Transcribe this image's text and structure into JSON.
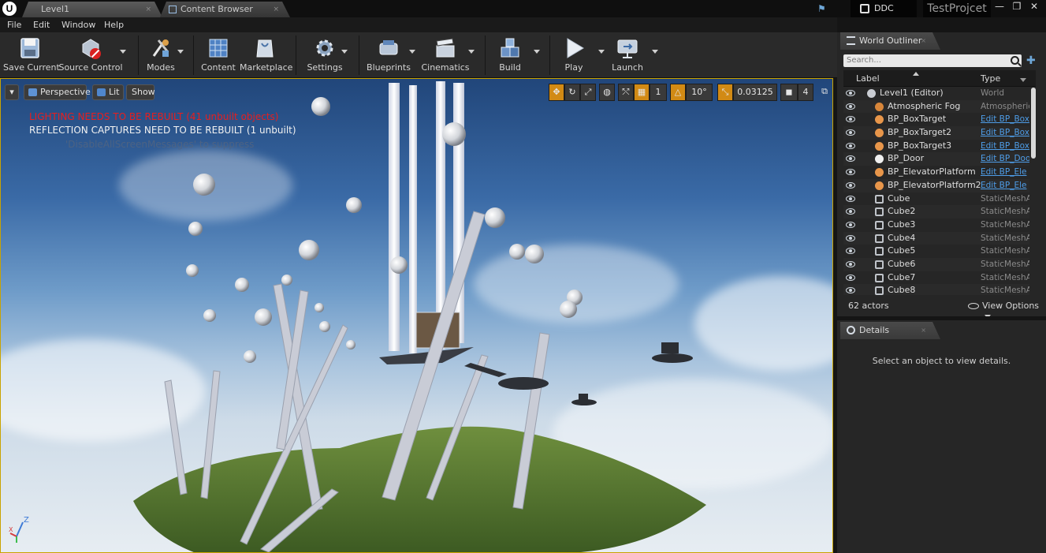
{
  "titlebar": {
    "logo": "U",
    "tabs": [
      {
        "label": "Level1"
      },
      {
        "label": "Content Browser"
      }
    ],
    "tab_close": "×",
    "ddc_label": "DDC",
    "project_name": "TestProjcet",
    "window_controls": {
      "minimize": "—",
      "maximize": "❐",
      "close": "✕"
    }
  },
  "menu": [
    "File",
    "Edit",
    "Window",
    "Help"
  ],
  "toolbar": {
    "buttons": [
      {
        "label": "Save Current",
        "icon": "save-icon"
      },
      {
        "label": "Source Control",
        "icon": "source-control-icon"
      },
      {
        "label": "Modes",
        "icon": "modes-icon"
      },
      {
        "label": "Content",
        "icon": "content-icon"
      },
      {
        "label": "Marketplace",
        "icon": "marketplace-icon"
      },
      {
        "label": "Settings",
        "icon": "settings-icon"
      },
      {
        "label": "Blueprints",
        "icon": "blueprints-icon"
      },
      {
        "label": "Cinematics",
        "icon": "cinematics-icon"
      },
      {
        "label": "Build",
        "icon": "build-icon"
      },
      {
        "label": "Play",
        "icon": "play-icon"
      },
      {
        "label": "Launch",
        "icon": "launch-icon"
      }
    ]
  },
  "viewport": {
    "menu_glyph": "▾",
    "perspective_label": "Perspective",
    "lit_label": "Lit",
    "show_label": "Show",
    "messages": {
      "lighting": "LIGHTING NEEDS TO BE REBUILT (41 unbuilt objects)",
      "reflection": "REFLECTION CAPTURES NEED TO BE REBUILT (1 unbuilt)",
      "suppress": "'DisableAllScreenMessages' to suppress"
    },
    "tools": {
      "grid_value": "1",
      "rotation_snap": "10°",
      "scale_snap": "0.03125",
      "camera_speed": "4"
    },
    "axis": {
      "x": "X",
      "z": "Z"
    }
  },
  "outliner": {
    "tab_label": "World Outliner",
    "search_placeholder": "Search...",
    "col_label": "Label",
    "col_type": "Type",
    "rows": [
      {
        "label": "Level1 (Editor)",
        "type": "World",
        "link": false,
        "icon": "level-icon",
        "indent": 0
      },
      {
        "label": "Atmospheric Fog",
        "type": "AtmosphericF",
        "link": false,
        "icon": "fog-icon",
        "indent": 1
      },
      {
        "label": "BP_BoxTarget",
        "type": "Edit BP_Box",
        "link": true,
        "icon": "blueprint-actor-icon",
        "indent": 1
      },
      {
        "label": "BP_BoxTarget2",
        "type": "Edit BP_Box",
        "link": true,
        "icon": "blueprint-actor-icon",
        "indent": 1
      },
      {
        "label": "BP_BoxTarget3",
        "type": "Edit BP_Box",
        "link": true,
        "icon": "blueprint-actor-icon",
        "indent": 1
      },
      {
        "label": "BP_Door",
        "type": "Edit BP_Doo",
        "link": true,
        "icon": "actor-icon",
        "indent": 1
      },
      {
        "label": "BP_ElevatorPlatform",
        "type": "Edit BP_Ele",
        "link": true,
        "icon": "blueprint-actor-icon",
        "indent": 1
      },
      {
        "label": "BP_ElevatorPlatform2",
        "type": "Edit BP_Ele",
        "link": true,
        "icon": "blueprint-actor-icon",
        "indent": 1
      },
      {
        "label": "Cube",
        "type": "StaticMeshAc",
        "link": false,
        "icon": "static-mesh-icon",
        "indent": 1
      },
      {
        "label": "Cube2",
        "type": "StaticMeshAc",
        "link": false,
        "icon": "static-mesh-icon",
        "indent": 1
      },
      {
        "label": "Cube3",
        "type": "StaticMeshAc",
        "link": false,
        "icon": "static-mesh-icon",
        "indent": 1
      },
      {
        "label": "Cube4",
        "type": "StaticMeshAc",
        "link": false,
        "icon": "static-mesh-icon",
        "indent": 1
      },
      {
        "label": "Cube5",
        "type": "StaticMeshAc",
        "link": false,
        "icon": "static-mesh-icon",
        "indent": 1
      },
      {
        "label": "Cube6",
        "type": "StaticMeshAc",
        "link": false,
        "icon": "static-mesh-icon",
        "indent": 1
      },
      {
        "label": "Cube7",
        "type": "StaticMeshAc",
        "link": false,
        "icon": "static-mesh-icon",
        "indent": 1
      },
      {
        "label": "Cube8",
        "type": "StaticMeshAc",
        "link": false,
        "icon": "static-mesh-icon",
        "indent": 1
      }
    ],
    "actor_count": "62 actors",
    "view_options": "View Options"
  },
  "details": {
    "tab_label": "Details",
    "empty_message": "Select an object to view details."
  },
  "colors": {
    "accent": "#d28a14",
    "selection_border": "#c9a300",
    "error_text": "#e81e1e",
    "link": "#4e9de8"
  }
}
